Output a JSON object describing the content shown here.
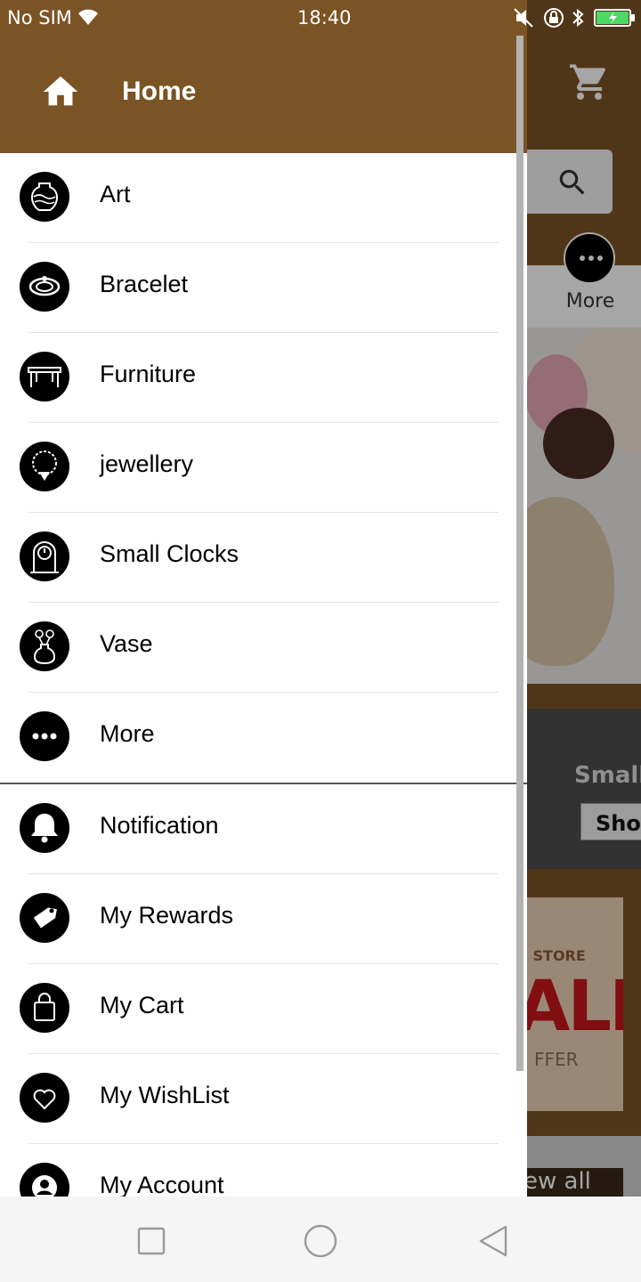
{
  "status_bar": {
    "carrier": "No SIM",
    "time": "18:40",
    "icons": [
      "wifi-icon",
      "mute-icon",
      "lock-icon",
      "bluetooth-icon",
      "battery-icon"
    ]
  },
  "background": {
    "more_label": "More",
    "small_label": "Small",
    "shop_label": "Shop",
    "sale_store": "E STORE",
    "sale_big": "ALE",
    "sale_offer": "FFER",
    "view_all": "ew all"
  },
  "drawer": {
    "header_title": "Home",
    "categories": [
      {
        "label": "Art",
        "icon": "art-vase-icon"
      },
      {
        "label": "Bracelet",
        "icon": "bracelet-icon"
      },
      {
        "label": "Furniture",
        "icon": "furniture-icon"
      },
      {
        "label": "jewellery",
        "icon": "jewellery-icon"
      },
      {
        "label": "Small Clocks",
        "icon": "clock-icon"
      },
      {
        "label": "Vase",
        "icon": "vase-icon"
      },
      {
        "label": "More",
        "icon": "more-icon"
      }
    ],
    "account_items": [
      {
        "label": "Notification",
        "icon": "bell-icon"
      },
      {
        "label": "My Rewards",
        "icon": "tag-icon"
      },
      {
        "label": "My Cart",
        "icon": "bag-icon"
      },
      {
        "label": "My WishList",
        "icon": "heart-icon"
      },
      {
        "label": "My Account",
        "icon": "account-icon"
      }
    ]
  },
  "colors": {
    "brand": "#7b5425",
    "drawer_bg": "#ffffff",
    "icon_bg": "#000000"
  }
}
